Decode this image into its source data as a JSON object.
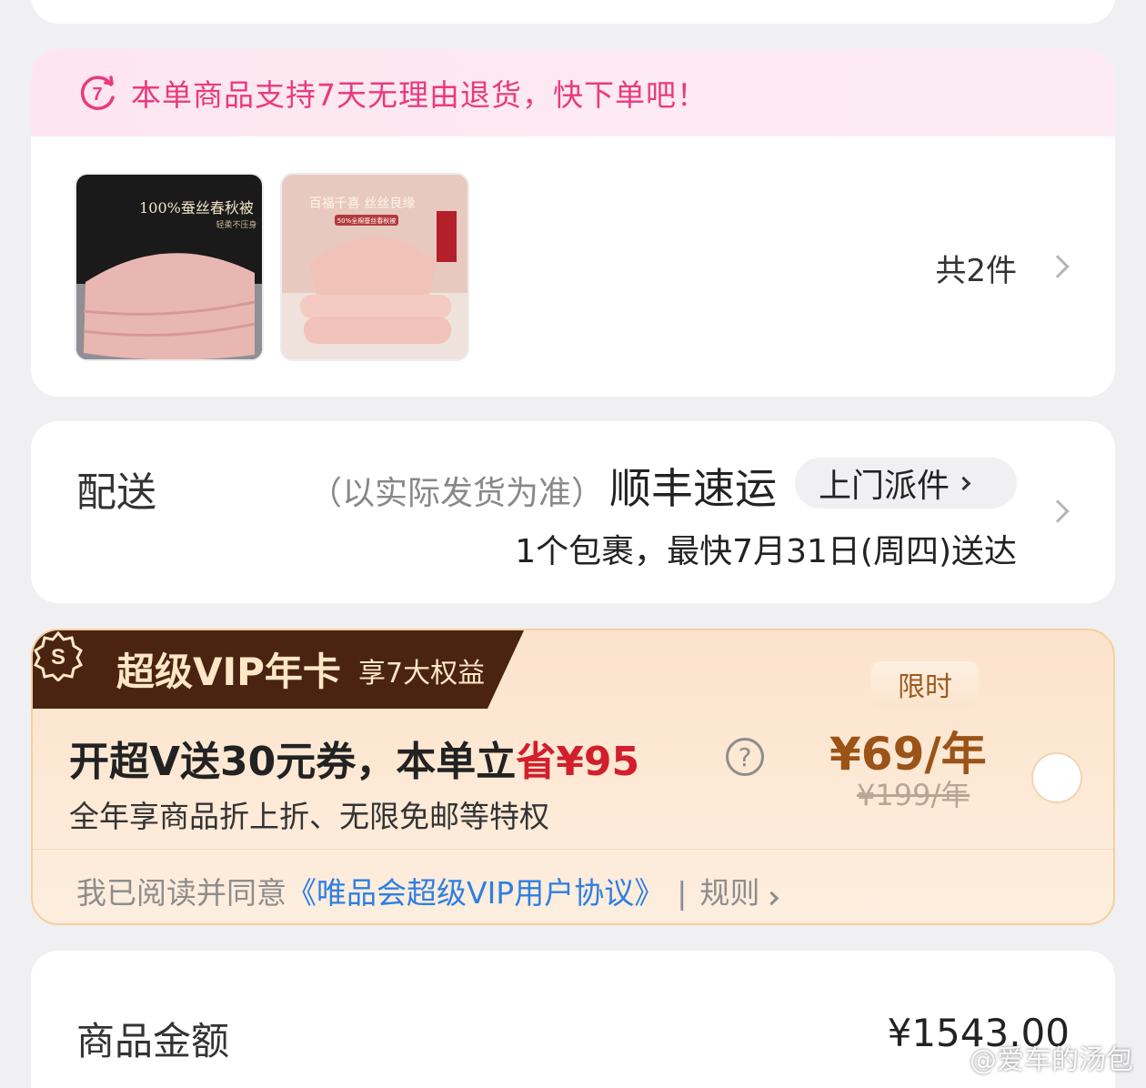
{
  "returns_banner": {
    "text": "本单商品支持7天无理由退货，快下单吧！",
    "accent_color": "#ea3a7e"
  },
  "goods": {
    "items": [
      {
        "image_text": "100%蚕丝春秋被",
        "image_subtext": "轻柔不压身"
      },
      {
        "image_text": "百福千喜 丝丝良缘",
        "image_subtext": "50%全棉蚕丝春秋被"
      }
    ],
    "count_label": "共2件"
  },
  "delivery": {
    "label": "配送",
    "note": "（以实际发货为准）",
    "carrier": "顺丰速运",
    "pickup_label": "上门派件",
    "eta": "1个包裹，最快7月31日(周四)送达"
  },
  "vip": {
    "title": "超级VIP年卡",
    "subtitle": "享7大权益",
    "limited_tag": "限时",
    "headline_prefix": "开超V送30元券，本单立",
    "headline_save": "省¥95",
    "help_icon_glyph": "?",
    "price": "¥69/年",
    "original_price": "¥199/年",
    "description": "全年享商品折上折、无限免邮等特权",
    "agree_prefix": "我已阅读并同意",
    "agree_link": "《唯品会超级VIP用户协议》",
    "rules_label": "规则"
  },
  "summary": {
    "amount_label": "商品金额",
    "amount_value": "¥1543.00"
  },
  "watermark": "@爱车的汤包",
  "colors": {
    "vip_dark": "#4a2410",
    "save_red": "#d21f2b",
    "link_blue": "#2e7fe0",
    "vip_price": "#9b5318"
  }
}
